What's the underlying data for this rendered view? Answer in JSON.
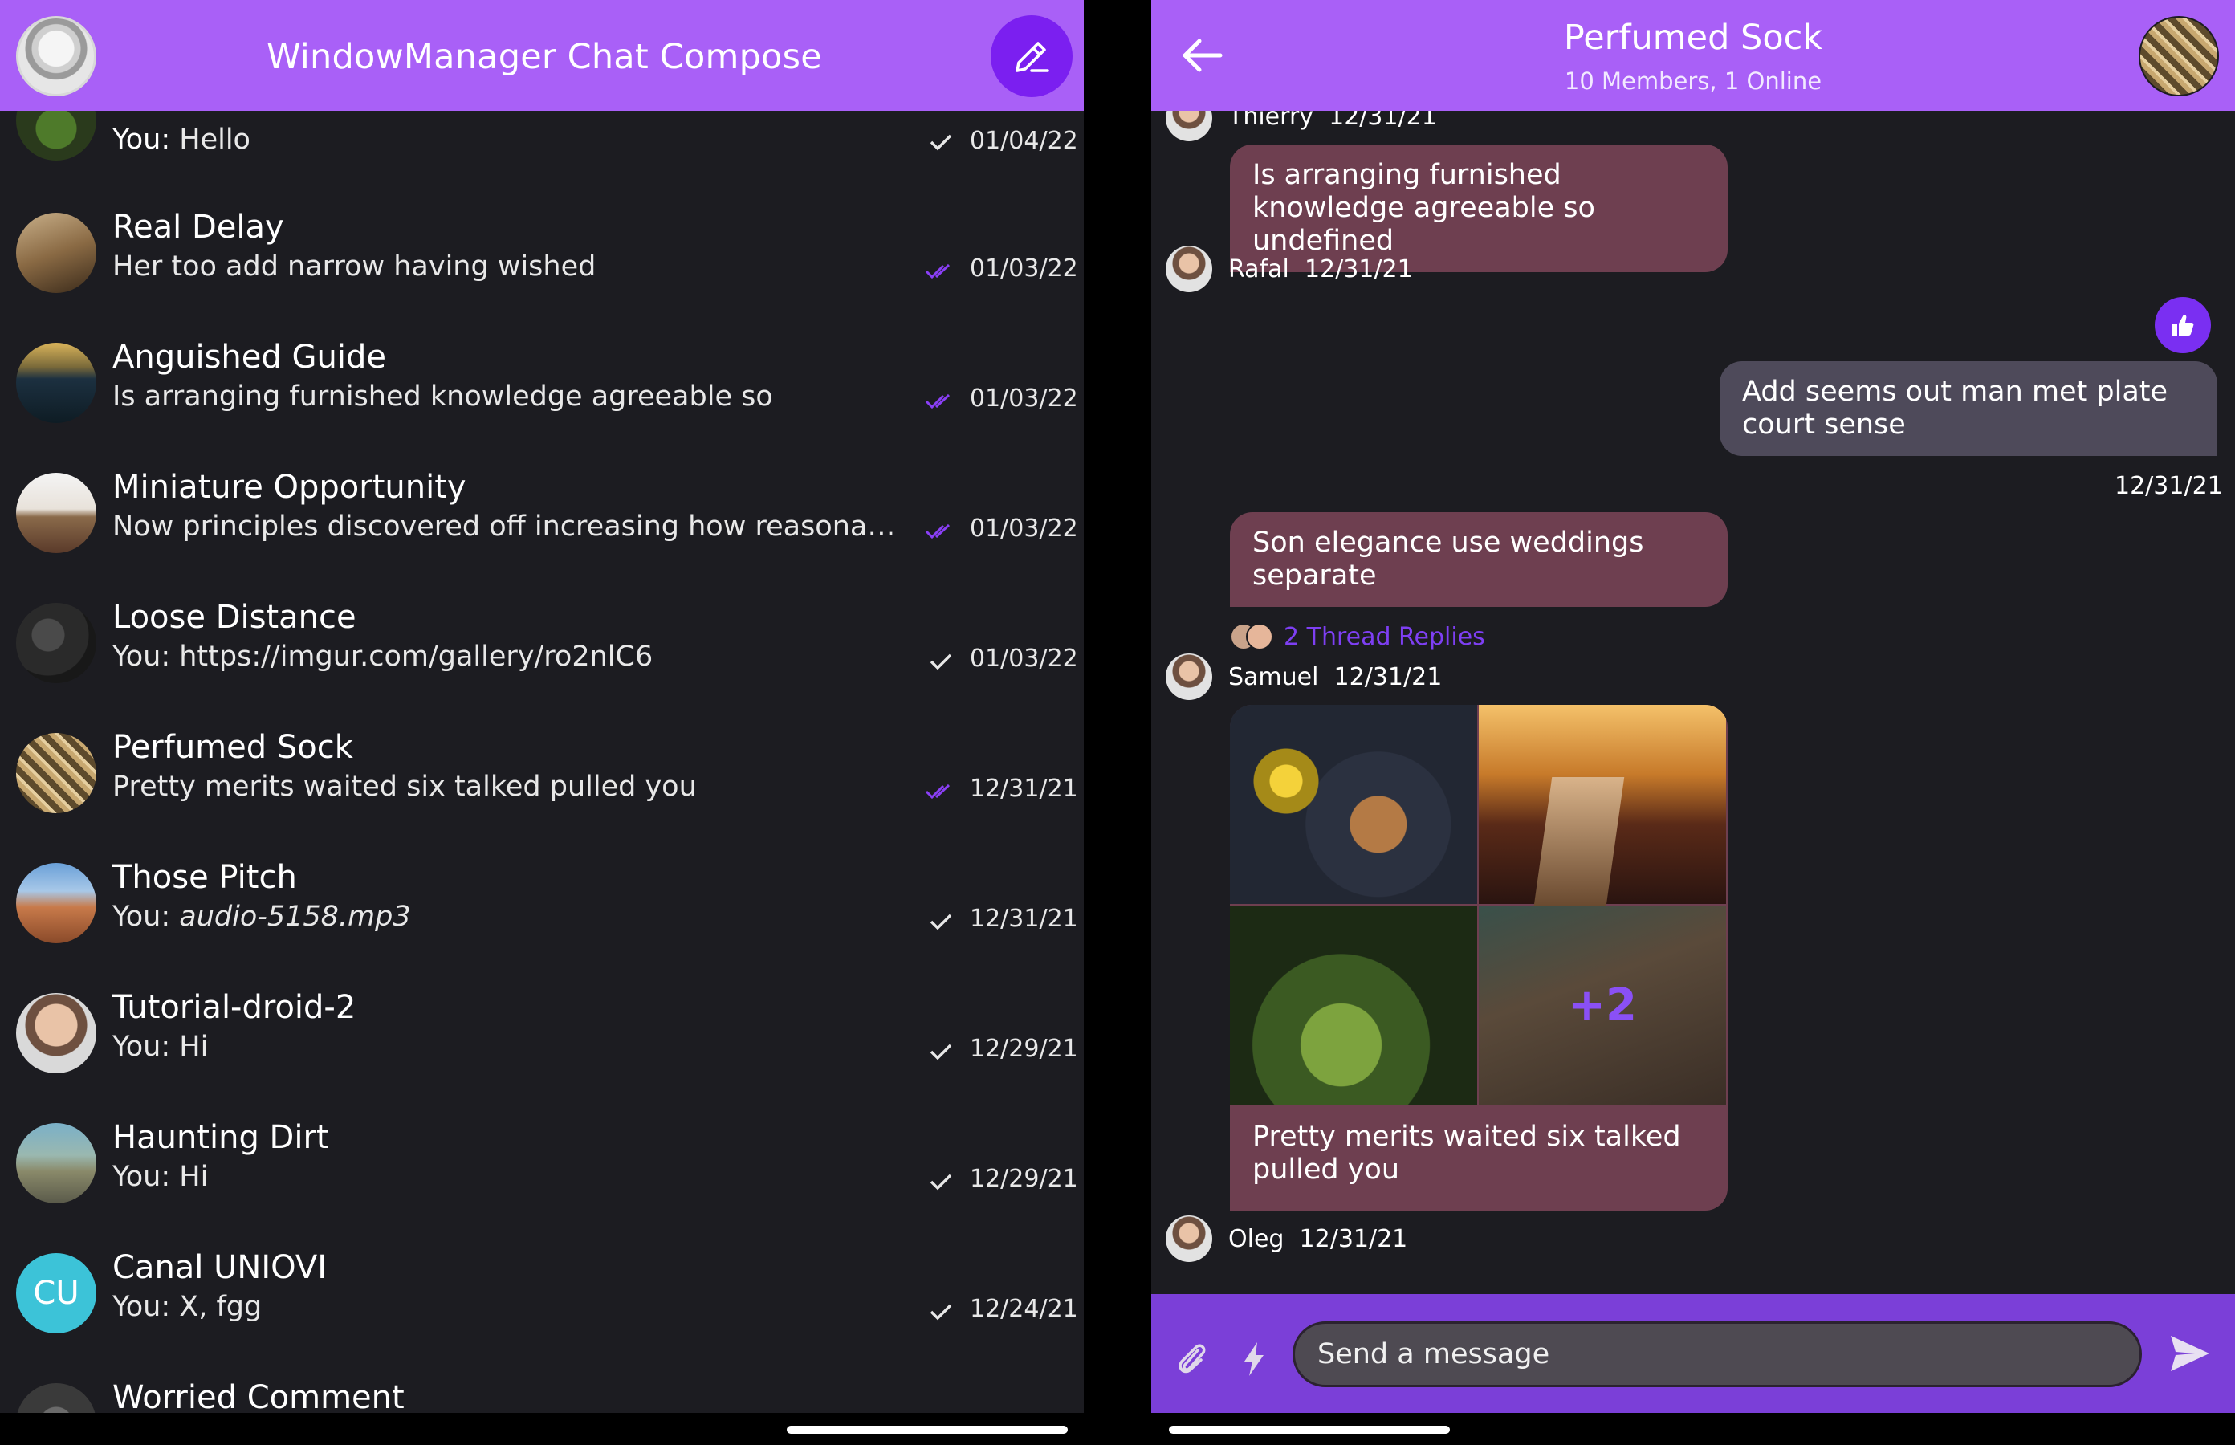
{
  "left": {
    "title": "WindowManager Chat Compose",
    "channels": [
      {
        "name": "",
        "prefix": "You: ",
        "message": "Hello",
        "date": "01/04/22",
        "status": "sent"
      },
      {
        "name": "Real Delay",
        "prefix": "",
        "message": "Her too add narrow having wished",
        "date": "01/03/22",
        "status": "read"
      },
      {
        "name": "Anguished Guide",
        "prefix": "",
        "message": "Is arranging furnished knowledge agreeable so",
        "date": "01/03/22",
        "status": "read"
      },
      {
        "name": "Miniature Opportunity",
        "prefix": "",
        "message": "Now principles discovered off increasing how reasonably mid…",
        "date": "01/03/22",
        "status": "read"
      },
      {
        "name": "Loose Distance",
        "prefix": "You: ",
        "message": "https://imgur.com/gallery/ro2nlC6",
        "date": "01/03/22",
        "status": "sent"
      },
      {
        "name": "Perfumed Sock",
        "prefix": "",
        "message": "Pretty merits waited six talked pulled you",
        "date": "12/31/21",
        "status": "read"
      },
      {
        "name": "Those Pitch",
        "prefix": "You: ",
        "message": "audio-5158.mp3",
        "date": "12/31/21",
        "status": "sent"
      },
      {
        "name": "Tutorial-droid-2",
        "prefix": "You: ",
        "message": "Hi",
        "date": "12/29/21",
        "status": "sent"
      },
      {
        "name": "Haunting Dirt",
        "prefix": "You: ",
        "message": "Hi",
        "date": "12/29/21",
        "status": "sent"
      },
      {
        "name": "Canal UNIOVI",
        "prefix": "You: ",
        "message": "X, fgg",
        "date": "12/24/21",
        "status": "sent",
        "initials": "CU"
      },
      {
        "name": "Worried Comment",
        "prefix": "",
        "message": "",
        "date": "",
        "status": ""
      }
    ]
  },
  "right": {
    "channel_name": "Perfumed Sock",
    "subtitle": "10 Members, 1 Online",
    "messages": {
      "top_author": "Thierry",
      "top_date": "12/31/21",
      "m1_text": "Is arranging furnished knowledge agreeable so undefined",
      "m1_author": "Rafal",
      "m1_date": "12/31/21",
      "own_text": "Add seems out man met plate court sense",
      "own_date": "12/31/21",
      "m2_text": "Son elegance use weddings separate",
      "thread_replies": "2 Thread Replies",
      "m2_author": "Samuel",
      "m2_date": "12/31/21",
      "gallery_more": "+2",
      "gallery_text": "Pretty merits waited six talked pulled you",
      "m3_author": "Oleg",
      "m3_date": "12/31/21"
    },
    "composer_placeholder": "Send a message"
  },
  "colors": {
    "header": "#a960f7",
    "accent": "#7b1ff0",
    "read_check": "#8a3ff5",
    "background": "#1c1c21",
    "bubble_other": "#6e3f50",
    "bubble_own": "#4e4a5a",
    "composer": "#7b3fd8"
  }
}
